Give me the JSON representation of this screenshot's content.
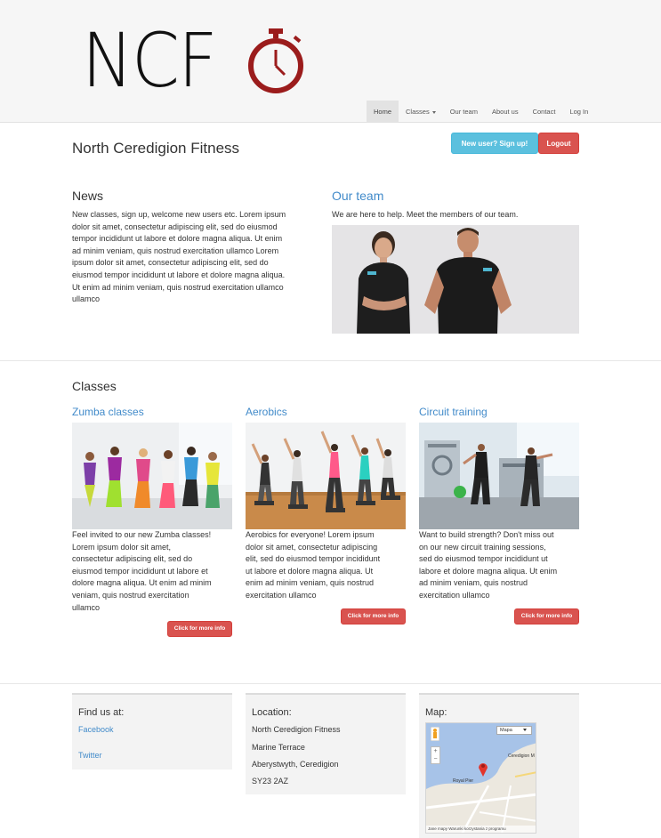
{
  "header": {
    "logo_text": "NCF",
    "nav": [
      {
        "label": "Home",
        "active": true
      },
      {
        "label": "Classes",
        "dropdown": true
      },
      {
        "label": "Our team"
      },
      {
        "label": "About us"
      },
      {
        "label": "Contact"
      },
      {
        "label": "Log In"
      }
    ]
  },
  "title_row": {
    "title": "North Ceredigion Fitness",
    "signup_label": "New user? Sign up!",
    "logout_label": "Logout"
  },
  "news": {
    "heading": "News",
    "lines": [
      "New classes, sign up, welcome new users etc. Lorem ipsum",
      "dolor sit amet, consectetur adipiscing elit, sed do eiusmod",
      "tempor incididunt ut labore et dolore magna aliqua. Ut enim",
      "ad minim veniam, quis nostrud exercitation ullamco Lorem",
      "ipsum dolor sit amet, consectetur adipiscing elit, sed do",
      "eiusmod tempor incididunt ut labore et dolore magna aliqua.",
      "Ut enim ad minim veniam, quis nostrud exercitation ullamco"
    ]
  },
  "team": {
    "heading": "Our team",
    "text": "We are here to help. Meet the members of our team."
  },
  "classes": {
    "heading": "Classes",
    "button_label": "Click for more info",
    "items": [
      {
        "title": "Zumba classes",
        "lines": [
          "Feel invited to our new Zumba classes!",
          "Lorem ipsum dolor sit amet,",
          "consectetur adipiscing elit, sed do",
          "eiusmod tempor incididunt ut labore et",
          "dolore magna aliqua. Ut enim ad minim",
          "veniam, quis nostrud exercitation",
          "ullamco"
        ]
      },
      {
        "title": "Aerobics",
        "lines": [
          "Aerobics for everyone! Lorem ipsum",
          "dolor sit amet, consectetur adipiscing",
          "elit, sed do eiusmod tempor incididunt",
          "ut labore et dolore magna aliqua. Ut",
          "enim ad minim veniam, quis nostrud",
          "exercitation ullamco"
        ]
      },
      {
        "title": "Circuit training",
        "lines": [
          "Want to build strength? Don't miss out",
          "on our new circuit training sessions,",
          "sed do eiusmod tempor incididunt ut",
          "labore et dolore magna aliqua. Ut enim",
          "ad minim veniam, quis nostrud",
          "exercitation ullamco"
        ]
      }
    ]
  },
  "footer": {
    "find_us": {
      "heading": "Find us at:",
      "facebook": "Facebook",
      "twitter": "Twitter"
    },
    "location": {
      "heading": "Location:",
      "lines": [
        "North Ceredigion Fitness",
        "Marine Terrace",
        "Aberystwyth, Ceredigion",
        "SY23 2AZ"
      ]
    },
    "map": {
      "heading": "Map:",
      "type_select": "Mapa",
      "labels": [
        "Ceredigion M",
        "Royal Pier",
        "Jane mapy",
        "Warunki korzystania z programu"
      ]
    }
  },
  "colors": {
    "accent_blue": "#428bca",
    "info": "#5bc0de",
    "danger": "#d9534f",
    "logo_red": "#9b1c1c"
  }
}
